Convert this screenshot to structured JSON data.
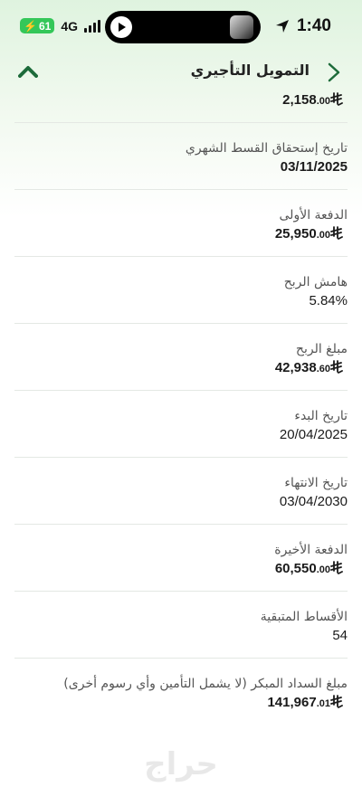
{
  "status_bar": {
    "time": "1:40",
    "battery": "61",
    "network": "4G"
  },
  "header": {
    "title": "التمويل التأجيري"
  },
  "currency_symbol": "riyal-symbol",
  "fields": [
    {
      "label": "",
      "value_int": "2,158",
      "value_dec": ".00",
      "currency": true
    },
    {
      "label": "تاريخ إستحقاق القسط الشهري",
      "value": "03/11/2025"
    },
    {
      "label": "الدفعة الأولى",
      "value_int": "25,950",
      "value_dec": ".00",
      "currency": true
    },
    {
      "label": "هامش الربح",
      "value": "5.84%"
    },
    {
      "label": "مبلغ الربح",
      "value_int": "42,938",
      "value_dec": ".60",
      "currency": true
    },
    {
      "label": "تاريخ البدء",
      "value": "20/04/2025"
    },
    {
      "label": "تاريخ الانتهاء",
      "value": "03/04/2030"
    },
    {
      "label": "الدفعة الأخيرة",
      "value_int": "60,550",
      "value_dec": ".00",
      "currency": true
    },
    {
      "label": "الأقساط المتبقية",
      "value": "54"
    },
    {
      "label": "مبلغ السداد المبكر (لا يشمل التأمين وأي رسوم أخرى)",
      "value_int": "141,967",
      "value_dec": ".01",
      "currency": true
    }
  ],
  "watermark": "حراج",
  "colors": {
    "accent": "#1d6b3a",
    "battery": "#34c759"
  }
}
